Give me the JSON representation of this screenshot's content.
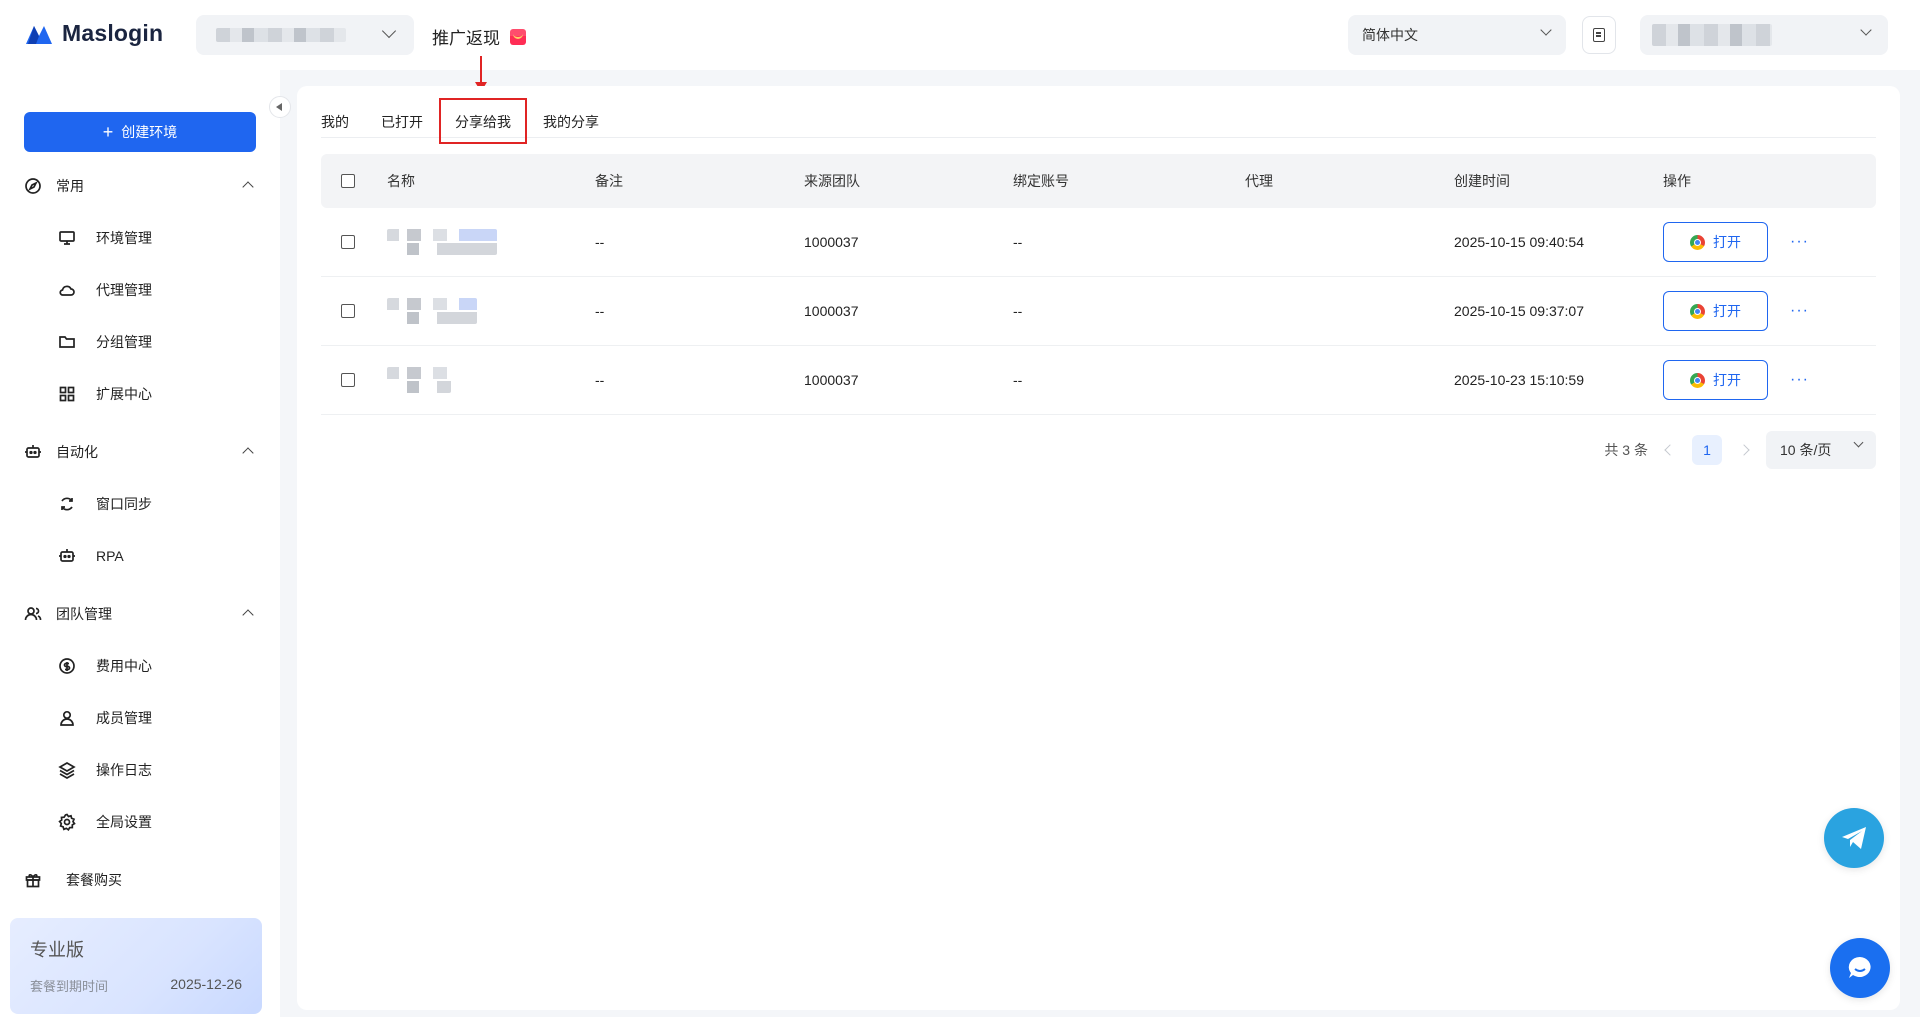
{
  "app": {
    "logo_text": "Maslogin",
    "promo_label": "推广返现",
    "language": "简体中文",
    "create_button": "创建环境"
  },
  "sidebar": {
    "groups": [
      {
        "label": "常用",
        "icon": "compass-icon",
        "items": [
          {
            "label": "环境管理",
            "icon": "monitor-icon"
          },
          {
            "label": "代理管理",
            "icon": "cloud-icon"
          },
          {
            "label": "分组管理",
            "icon": "folder-icon"
          },
          {
            "label": "扩展中心",
            "icon": "grid-icon"
          }
        ]
      },
      {
        "label": "自动化",
        "icon": "robot-icon",
        "items": [
          {
            "label": "窗口同步",
            "icon": "sync-icon"
          },
          {
            "label": "RPA",
            "icon": "robot-icon"
          }
        ]
      },
      {
        "label": "团队管理",
        "icon": "team-icon",
        "items": [
          {
            "label": "费用中心",
            "icon": "dollar-icon"
          },
          {
            "label": "成员管理",
            "icon": "user-icon"
          },
          {
            "label": "操作日志",
            "icon": "layers-icon"
          },
          {
            "label": "全局设置",
            "icon": "gear-icon"
          }
        ]
      }
    ],
    "package": {
      "label": "套餐购买",
      "icon": "gift-box-icon"
    },
    "plan": {
      "name": "专业版",
      "expire_label": "套餐到期时间",
      "expire_date": "2025-12-26"
    }
  },
  "tabs": [
    "我的",
    "已打开",
    "分享给我",
    "我的分享"
  ],
  "active_tab": "分享给我",
  "table": {
    "headers": [
      "名称",
      "备注",
      "来源团队",
      "绑定账号",
      "代理",
      "创建时间",
      "操作"
    ],
    "rows": [
      {
        "note": "--",
        "team": "1000037",
        "account": "--",
        "proxy": "",
        "created": "2025-10-15 09:40:54",
        "action": "打开"
      },
      {
        "note": "--",
        "team": "1000037",
        "account": "--",
        "proxy": "",
        "created": "2025-10-15 09:37:07",
        "action": "打开"
      },
      {
        "note": "--",
        "team": "1000037",
        "account": "--",
        "proxy": "",
        "created": "2025-10-23 15:10:59",
        "action": "打开"
      }
    ]
  },
  "pagination": {
    "total_text": "共 3 条",
    "current_page": "1",
    "page_size": "10 条/页"
  },
  "colors": {
    "accent": "#1f66f0",
    "annotation": "#e02424",
    "telegram": "#2aa3e0"
  }
}
